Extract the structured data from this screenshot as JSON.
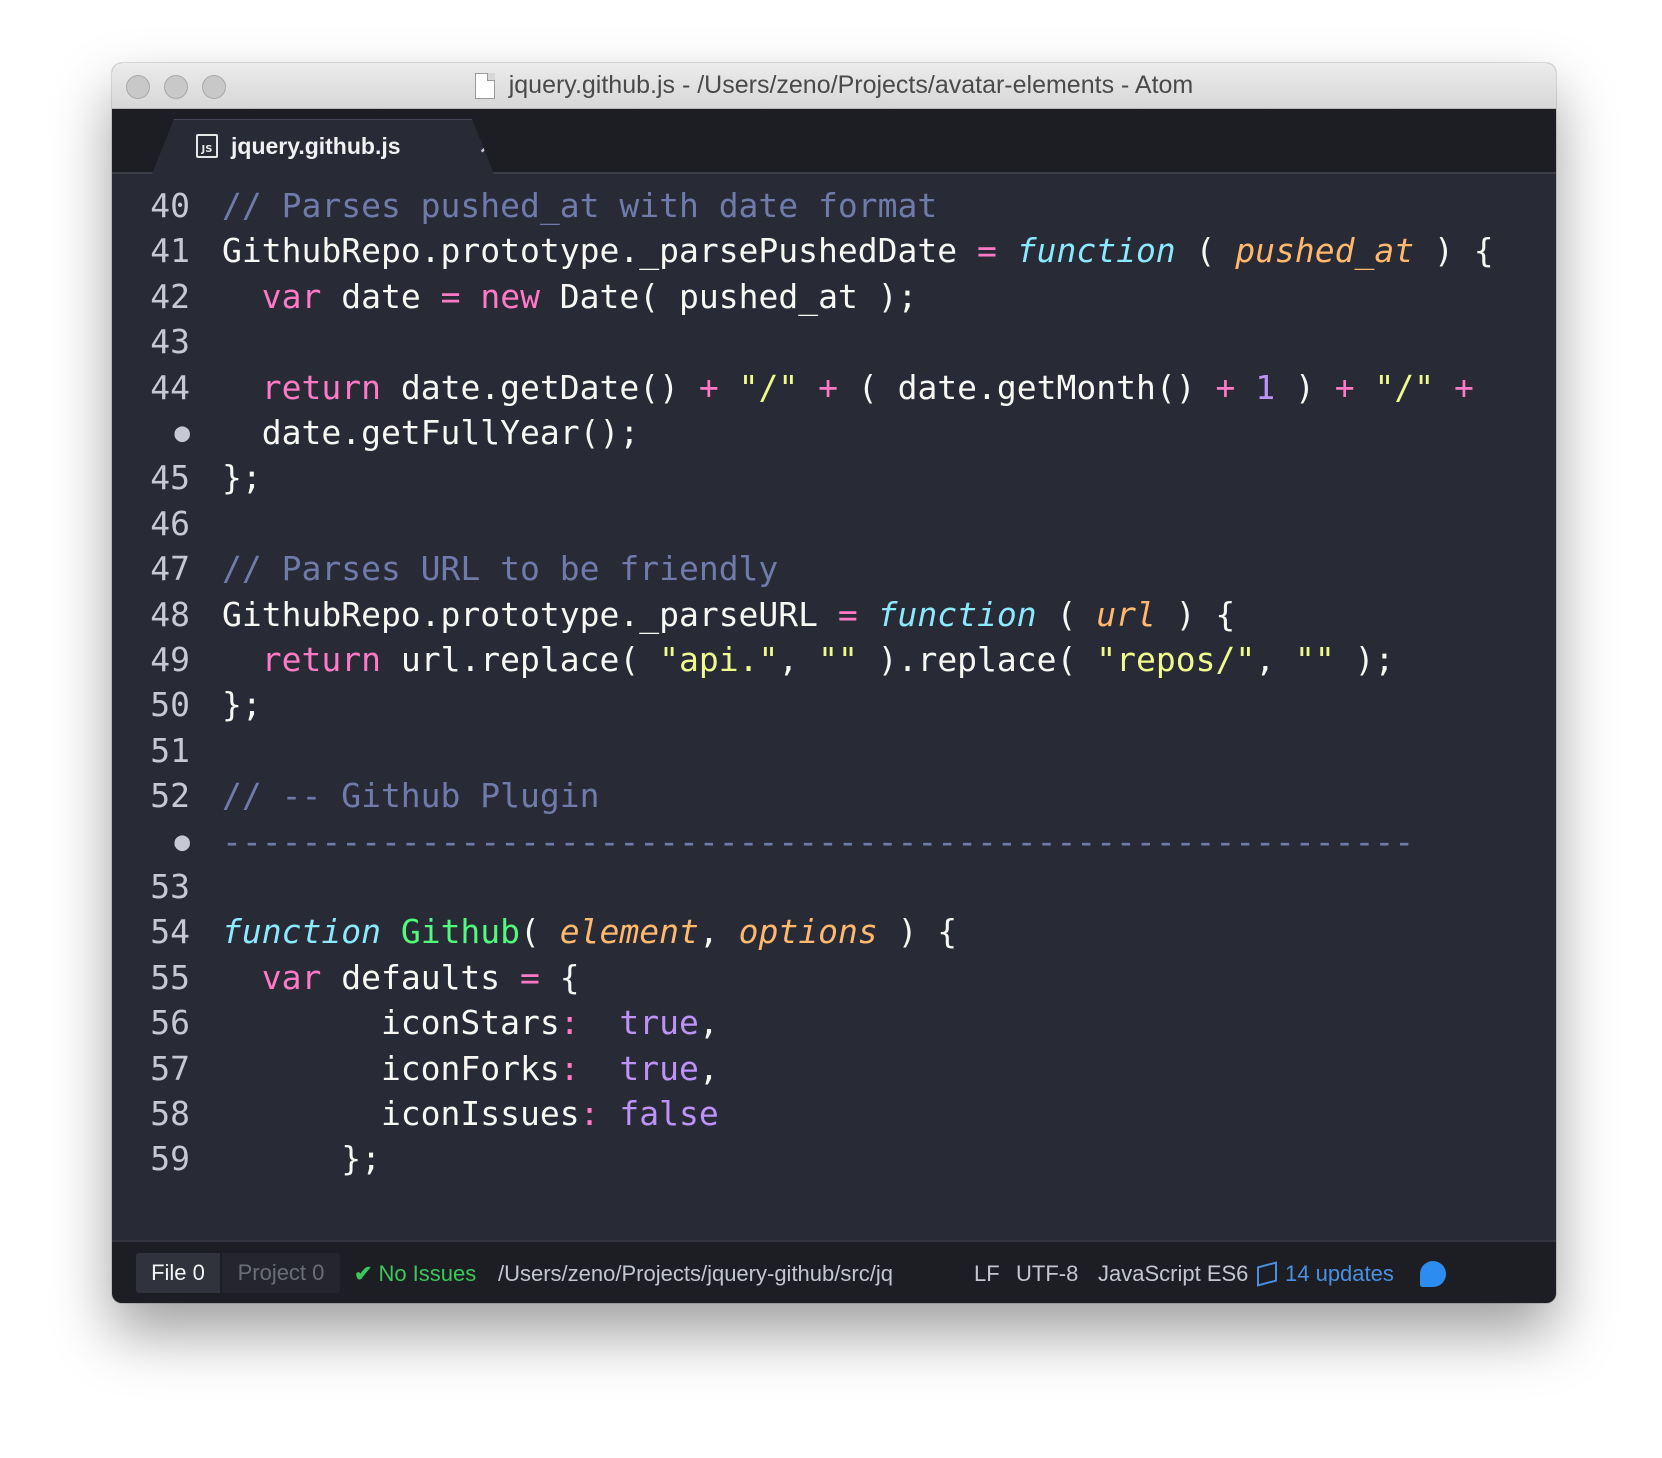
{
  "window": {
    "title": "jquery.github.js - /Users/zeno/Projects/avatar-elements - Atom"
  },
  "tab": {
    "icon_text": "JS",
    "label": "jquery.github.js",
    "close": "×"
  },
  "editor": {
    "lines": [
      {
        "gutter": "40",
        "tokens": [
          {
            "t": "// Parses pushed_at with date format",
            "c": "c"
          }
        ]
      },
      {
        "gutter": "41",
        "tokens": [
          {
            "t": "GithubRepo.prototype._parsePushedDate ",
            "c": ""
          },
          {
            "t": "=",
            "c": "k"
          },
          {
            "t": " ",
            "c": ""
          },
          {
            "t": "function",
            "c": "f"
          },
          {
            "t": " ( ",
            "c": ""
          },
          {
            "t": "pushed_at",
            "c": "p"
          },
          {
            "t": " ) {",
            "c": ""
          }
        ]
      },
      {
        "gutter": "42",
        "tokens": [
          {
            "t": "  ",
            "c": ""
          },
          {
            "t": "var",
            "c": "k"
          },
          {
            "t": " date ",
            "c": ""
          },
          {
            "t": "=",
            "c": "k"
          },
          {
            "t": " ",
            "c": ""
          },
          {
            "t": "new",
            "c": "k"
          },
          {
            "t": " Date( pushed_at );",
            "c": ""
          }
        ]
      },
      {
        "gutter": "43",
        "tokens": []
      },
      {
        "gutter": "44",
        "tokens": [
          {
            "t": "  ",
            "c": ""
          },
          {
            "t": "return",
            "c": "k"
          },
          {
            "t": " date.getDate() ",
            "c": ""
          },
          {
            "t": "+",
            "c": "k"
          },
          {
            "t": " ",
            "c": ""
          },
          {
            "t": "\"/\"",
            "c": "s"
          },
          {
            "t": " ",
            "c": ""
          },
          {
            "t": "+",
            "c": "k"
          },
          {
            "t": " ( date.getMonth() ",
            "c": ""
          },
          {
            "t": "+",
            "c": "k"
          },
          {
            "t": " ",
            "c": ""
          },
          {
            "t": "1",
            "c": "n"
          },
          {
            "t": " ) ",
            "c": ""
          },
          {
            "t": "+",
            "c": "k"
          },
          {
            "t": " ",
            "c": ""
          },
          {
            "t": "\"/\"",
            "c": "s"
          },
          {
            "t": " ",
            "c": ""
          },
          {
            "t": "+",
            "c": "k"
          }
        ]
      },
      {
        "gutter": "●",
        "dot": true,
        "tokens": [
          {
            "t": "  date.getFullYear();",
            "c": ""
          }
        ]
      },
      {
        "gutter": "45",
        "tokens": [
          {
            "t": "};",
            "c": ""
          }
        ]
      },
      {
        "gutter": "46",
        "tokens": []
      },
      {
        "gutter": "47",
        "tokens": [
          {
            "t": "// Parses URL to be friendly",
            "c": "c"
          }
        ]
      },
      {
        "gutter": "48",
        "tokens": [
          {
            "t": "GithubRepo.prototype._parseURL ",
            "c": ""
          },
          {
            "t": "=",
            "c": "k"
          },
          {
            "t": " ",
            "c": ""
          },
          {
            "t": "function",
            "c": "f"
          },
          {
            "t": " ( ",
            "c": ""
          },
          {
            "t": "url",
            "c": "p"
          },
          {
            "t": " ) {",
            "c": ""
          }
        ]
      },
      {
        "gutter": "49",
        "tokens": [
          {
            "t": "  ",
            "c": ""
          },
          {
            "t": "return",
            "c": "k"
          },
          {
            "t": " url.replace( ",
            "c": ""
          },
          {
            "t": "\"api.\"",
            "c": "s"
          },
          {
            "t": ", ",
            "c": ""
          },
          {
            "t": "\"\"",
            "c": "s"
          },
          {
            "t": " ).replace( ",
            "c": ""
          },
          {
            "t": "\"repos/\"",
            "c": "s"
          },
          {
            "t": ", ",
            "c": ""
          },
          {
            "t": "\"\"",
            "c": "s"
          },
          {
            "t": " );",
            "c": ""
          }
        ]
      },
      {
        "gutter": "50",
        "tokens": [
          {
            "t": "};",
            "c": ""
          }
        ]
      },
      {
        "gutter": "51",
        "tokens": []
      },
      {
        "gutter": "52",
        "tokens": [
          {
            "t": "// -- Github Plugin",
            "c": "c"
          }
        ]
      },
      {
        "gutter": "●",
        "dot": true,
        "tokens": [
          {
            "t": "------------------------------------------------------------",
            "c": "c"
          }
        ]
      },
      {
        "gutter": "53",
        "tokens": []
      },
      {
        "gutter": "54",
        "tokens": [
          {
            "t": "function",
            "c": "f"
          },
          {
            "t": " ",
            "c": ""
          },
          {
            "t": "Github",
            "c": "g"
          },
          {
            "t": "( ",
            "c": ""
          },
          {
            "t": "element",
            "c": "p"
          },
          {
            "t": ", ",
            "c": ""
          },
          {
            "t": "options",
            "c": "p"
          },
          {
            "t": " ) {",
            "c": ""
          }
        ]
      },
      {
        "gutter": "55",
        "tokens": [
          {
            "t": "  ",
            "c": ""
          },
          {
            "t": "var",
            "c": "k"
          },
          {
            "t": " defaults ",
            "c": ""
          },
          {
            "t": "=",
            "c": "k"
          },
          {
            "t": " {",
            "c": ""
          }
        ]
      },
      {
        "gutter": "56",
        "tokens": [
          {
            "t": "        iconStars",
            "c": ""
          },
          {
            "t": ":",
            "c": "k"
          },
          {
            "t": "  ",
            "c": ""
          },
          {
            "t": "true",
            "c": "n"
          },
          {
            "t": ",",
            "c": ""
          }
        ]
      },
      {
        "gutter": "57",
        "tokens": [
          {
            "t": "        iconForks",
            "c": ""
          },
          {
            "t": ":",
            "c": "k"
          },
          {
            "t": "  ",
            "c": ""
          },
          {
            "t": "true",
            "c": "n"
          },
          {
            "t": ",",
            "c": ""
          }
        ]
      },
      {
        "gutter": "58",
        "tokens": [
          {
            "t": "        iconIssues",
            "c": ""
          },
          {
            "t": ":",
            "c": "k"
          },
          {
            "t": " ",
            "c": ""
          },
          {
            "t": "false",
            "c": "n"
          }
        ]
      },
      {
        "gutter": "59",
        "tokens": [
          {
            "t": "      };",
            "c": ""
          }
        ]
      }
    ]
  },
  "status": {
    "file_label": "File 0",
    "project_label": "Project 0",
    "issues": "No Issues",
    "path": "/Users/zeno/Projects/jquery-github/src/jq",
    "line_ending": "LF",
    "encoding": "UTF-8",
    "grammar": "JavaScript ES6",
    "updates": "14 updates"
  }
}
